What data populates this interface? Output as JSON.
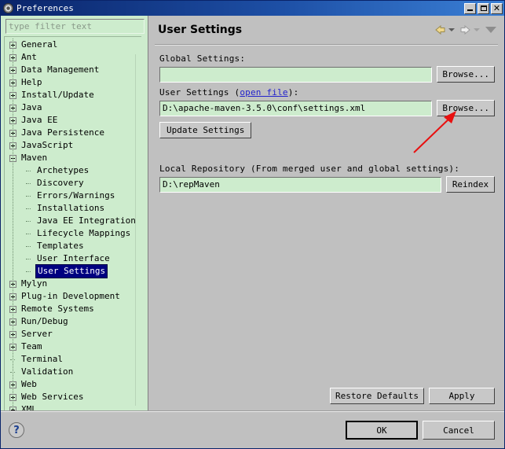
{
  "window": {
    "title": "Preferences",
    "icon": "preferences-gear-icon",
    "minimize_label": "Minimize",
    "maximize_label": "Maximize",
    "close_label": "Close"
  },
  "sidebar": {
    "filter": {
      "value": "",
      "placeholder": "type filter text"
    },
    "items": [
      {
        "label": "General",
        "state": "collapsed",
        "level": 0
      },
      {
        "label": "Ant",
        "state": "collapsed",
        "level": 0
      },
      {
        "label": "Data Management",
        "state": "collapsed",
        "level": 0
      },
      {
        "label": "Help",
        "state": "collapsed",
        "level": 0
      },
      {
        "label": "Install/Update",
        "state": "collapsed",
        "level": 0
      },
      {
        "label": "Java",
        "state": "collapsed",
        "level": 0
      },
      {
        "label": "Java EE",
        "state": "collapsed",
        "level": 0
      },
      {
        "label": "Java Persistence",
        "state": "collapsed",
        "level": 0
      },
      {
        "label": "JavaScript",
        "state": "collapsed",
        "level": 0
      },
      {
        "label": "Maven",
        "state": "expanded",
        "level": 0
      },
      {
        "label": "Archetypes",
        "state": "leaf",
        "level": 1
      },
      {
        "label": "Discovery",
        "state": "leaf",
        "level": 1
      },
      {
        "label": "Errors/Warnings",
        "state": "leaf",
        "level": 1
      },
      {
        "label": "Installations",
        "state": "leaf",
        "level": 1
      },
      {
        "label": "Java EE Integration",
        "state": "leaf",
        "level": 1
      },
      {
        "label": "Lifecycle Mappings",
        "state": "leaf",
        "level": 1
      },
      {
        "label": "Templates",
        "state": "leaf",
        "level": 1
      },
      {
        "label": "User Interface",
        "state": "leaf",
        "level": 1
      },
      {
        "label": "User Settings",
        "state": "selected",
        "level": 1
      },
      {
        "label": "Mylyn",
        "state": "collapsed",
        "level": 0
      },
      {
        "label": "Plug-in Development",
        "state": "collapsed",
        "level": 0
      },
      {
        "label": "Remote Systems",
        "state": "collapsed",
        "level": 0
      },
      {
        "label": "Run/Debug",
        "state": "collapsed",
        "level": 0
      },
      {
        "label": "Server",
        "state": "collapsed",
        "level": 0
      },
      {
        "label": "Team",
        "state": "collapsed",
        "level": 0
      },
      {
        "label": "Terminal",
        "state": "leaf0",
        "level": 0
      },
      {
        "label": "Validation",
        "state": "leaf0",
        "level": 0
      },
      {
        "label": "Web",
        "state": "collapsed",
        "level": 0
      },
      {
        "label": "Web Services",
        "state": "collapsed",
        "level": 0
      },
      {
        "label": "XML",
        "state": "collapsed",
        "level": 0
      }
    ]
  },
  "page": {
    "title": "User Settings",
    "nav_back": "back-icon",
    "nav_forward": "forward-icon",
    "nav_menu": "dropdown-icon"
  },
  "form": {
    "global_settings_label": "Global Settings:",
    "global_settings_value": "",
    "global_browse_label": "Browse...",
    "user_settings_label_prefix": "User Settings (",
    "user_settings_link": "open file",
    "user_settings_label_suffix": "):",
    "user_settings_value": "D:\\apache-maven-3.5.0\\conf\\settings.xml",
    "user_browse_label": "Browse...",
    "update_settings_label": "Update Settings",
    "local_repo_label": "Local Repository (From merged user and global settings):",
    "local_repo_value": "D:\\repMaven",
    "reindex_label": "Reindex"
  },
  "actions": {
    "restore_defaults": "Restore Defaults",
    "apply": "Apply",
    "ok": "OK",
    "cancel": "Cancel",
    "help": "?"
  },
  "annotation": {
    "type": "red-arrow",
    "color": "#e81010",
    "points_to": "user-settings-browse-button"
  },
  "colors": {
    "titlebar": "#0a246a",
    "dialog_bg": "#c0c0c0",
    "tree_bg": "#cdeccd",
    "input_bg": "#cdeccd",
    "selection": "#000080",
    "link": "#2222cc",
    "annotation": "#e81010"
  }
}
